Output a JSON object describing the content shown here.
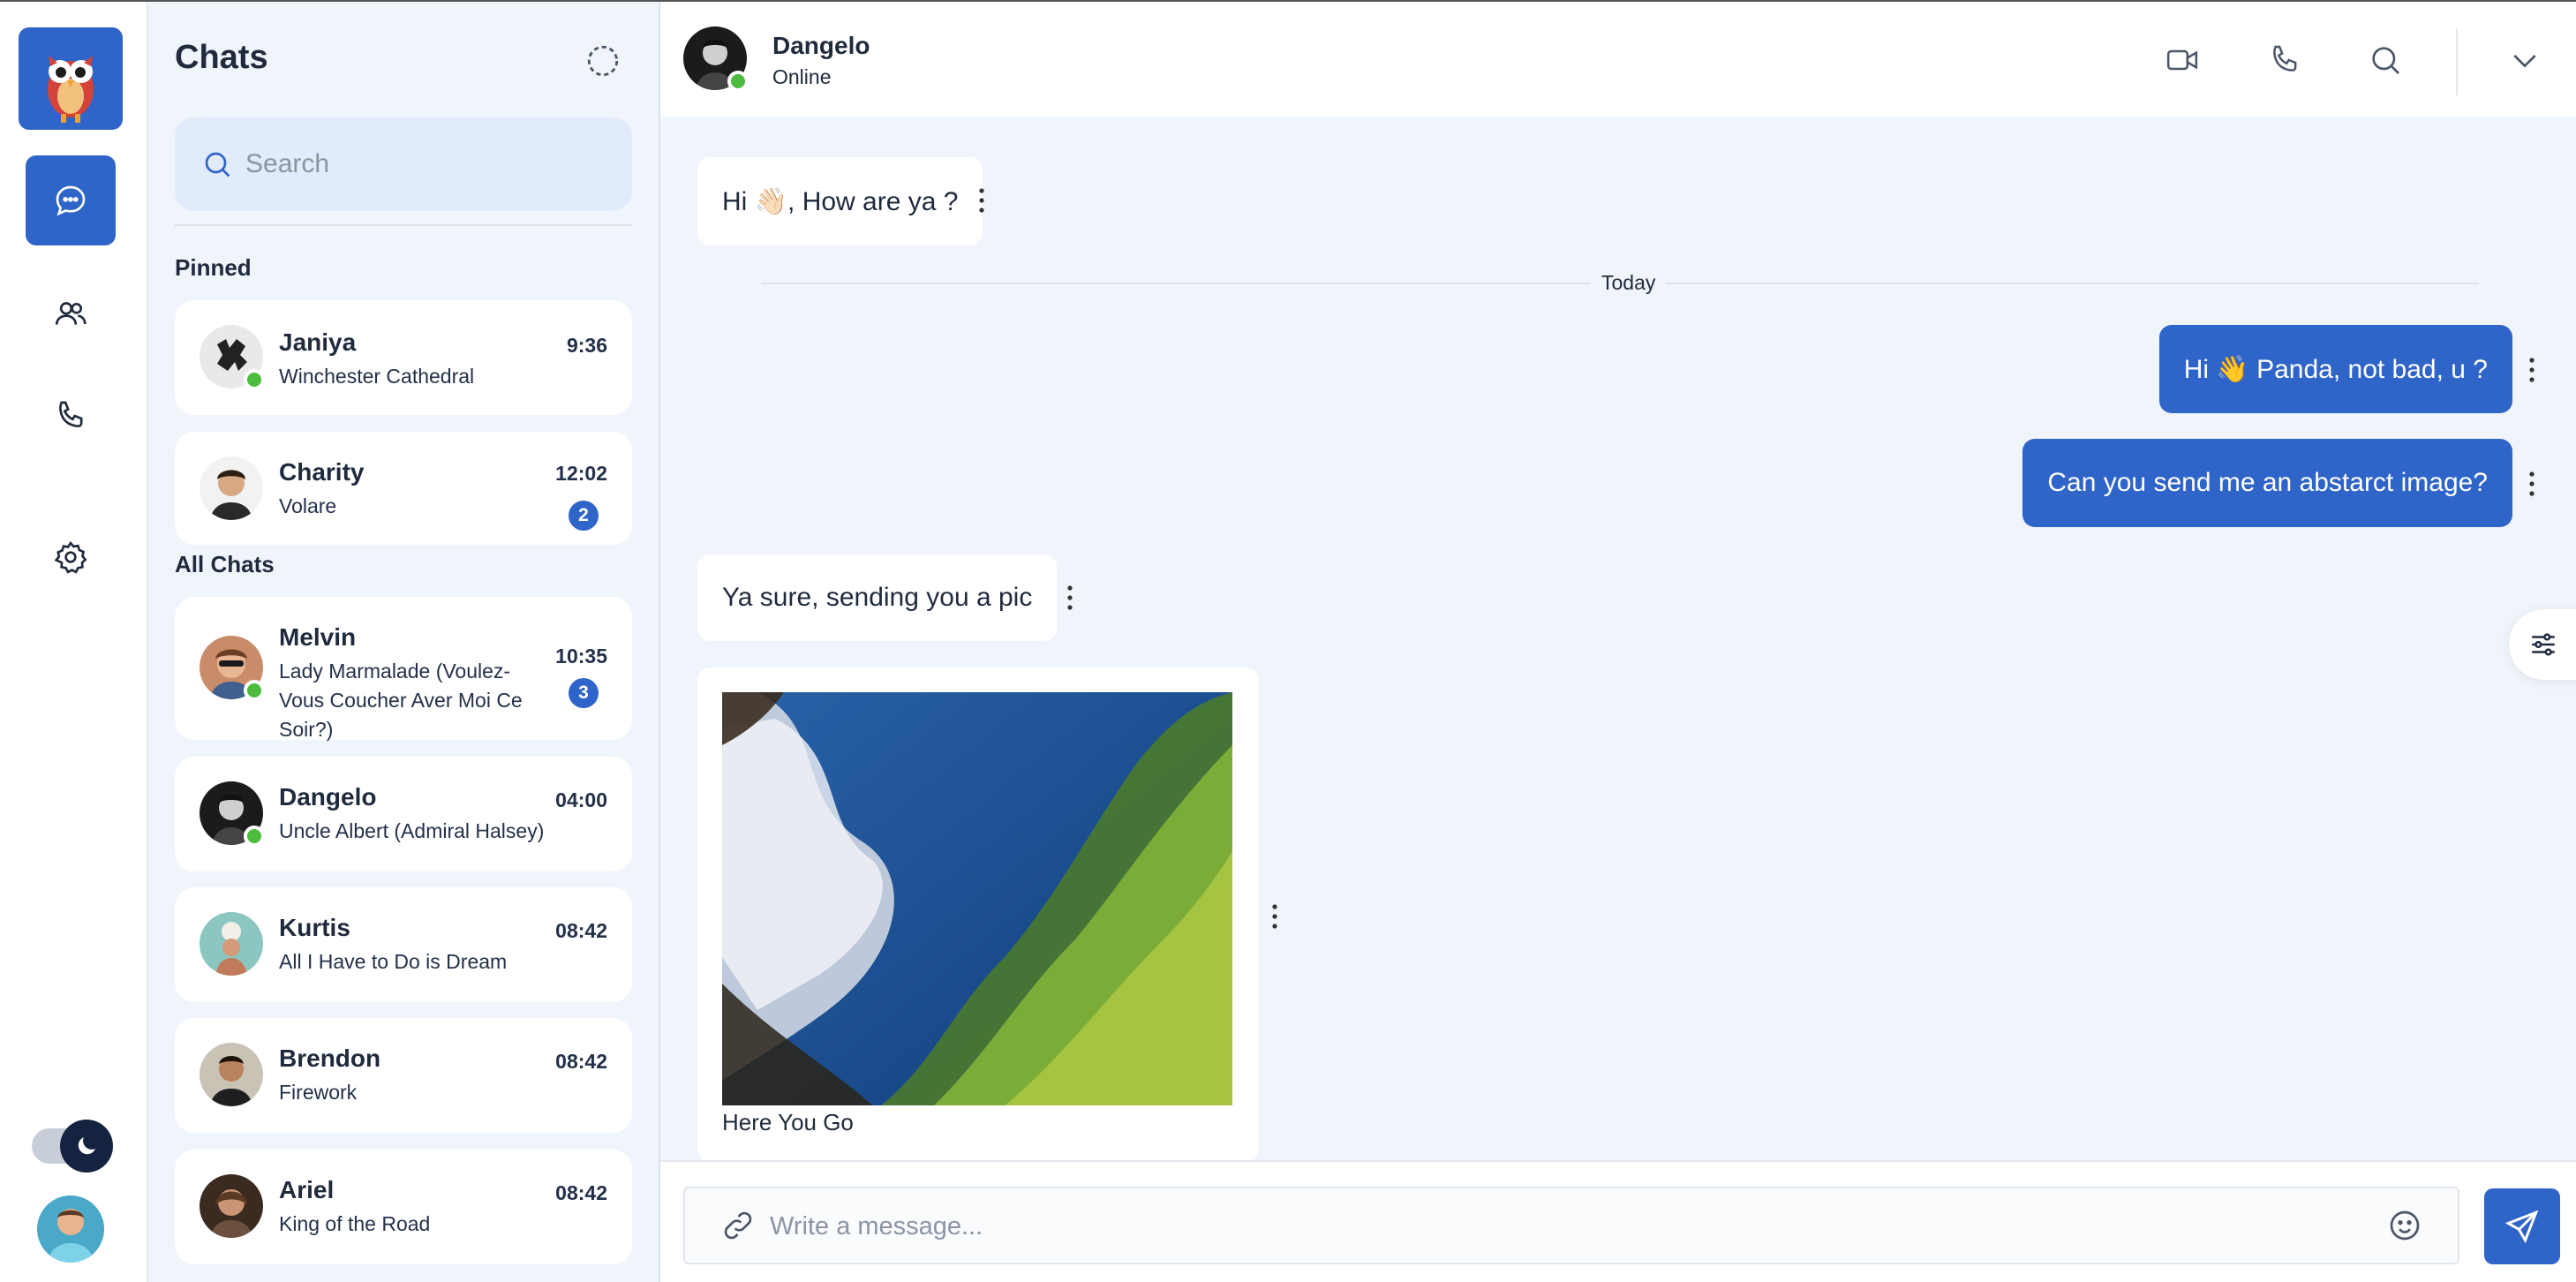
{
  "app": {
    "accent_color": "#2f64c8",
    "online_color": "#4cbb3e"
  },
  "rail": {
    "items": [
      {
        "name": "chats",
        "icon": "chat-bubble-icon",
        "active": true
      },
      {
        "name": "contacts",
        "icon": "users-icon",
        "active": false
      },
      {
        "name": "calls",
        "icon": "phone-icon",
        "active": false
      },
      {
        "name": "settings",
        "icon": "gear-icon",
        "active": false
      }
    ],
    "theme_toggle_icon": "moon-icon"
  },
  "chatlist": {
    "title": "Chats",
    "search_placeholder": "Search",
    "pinned_label": "Pinned",
    "all_label": "All Chats",
    "pinned": [
      {
        "name": "Janiya",
        "message": "Winchester Cathedral",
        "time": "9:36",
        "online": true,
        "unread": ""
      },
      {
        "name": "Charity",
        "message": "Volare",
        "time": "12:02",
        "online": false,
        "unread": "2"
      }
    ],
    "all": [
      {
        "name": "Melvin",
        "message": "Lady Marmalade (Voulez-Vous Coucher Aver Moi Ce Soir?)",
        "time": "10:35",
        "online": true,
        "unread": "3"
      },
      {
        "name": "Dangelo",
        "message": "Uncle Albert (Admiral Halsey)",
        "time": "04:00",
        "online": true,
        "unread": ""
      },
      {
        "name": "Kurtis",
        "message": "All I Have to Do is Dream",
        "time": "08:42",
        "online": false,
        "unread": ""
      },
      {
        "name": "Brendon",
        "message": "Firework",
        "time": "08:42",
        "online": false,
        "unread": ""
      },
      {
        "name": "Ariel",
        "message": "King of the Road",
        "time": "08:42",
        "online": false,
        "unread": ""
      }
    ]
  },
  "conversation": {
    "contact_name": "Dangelo",
    "contact_status": "Online",
    "header_icons": [
      "video-camera-icon",
      "phone-icon",
      "search-icon",
      "chevron-down-icon"
    ],
    "day_separator": "Today",
    "messages": [
      {
        "direction": "in",
        "text": "Hi 👋🏻, How are ya ?"
      },
      {
        "direction": "out",
        "text": "Hi 👋 Panda, not bad, u ?"
      },
      {
        "direction": "out",
        "text": "Can you send me an abstarct image?"
      },
      {
        "direction": "in",
        "text": "Ya sure, sending you a pic"
      },
      {
        "direction": "in",
        "type": "image",
        "caption": "Here You Go"
      }
    ],
    "composer_placeholder": "Write a message..."
  }
}
